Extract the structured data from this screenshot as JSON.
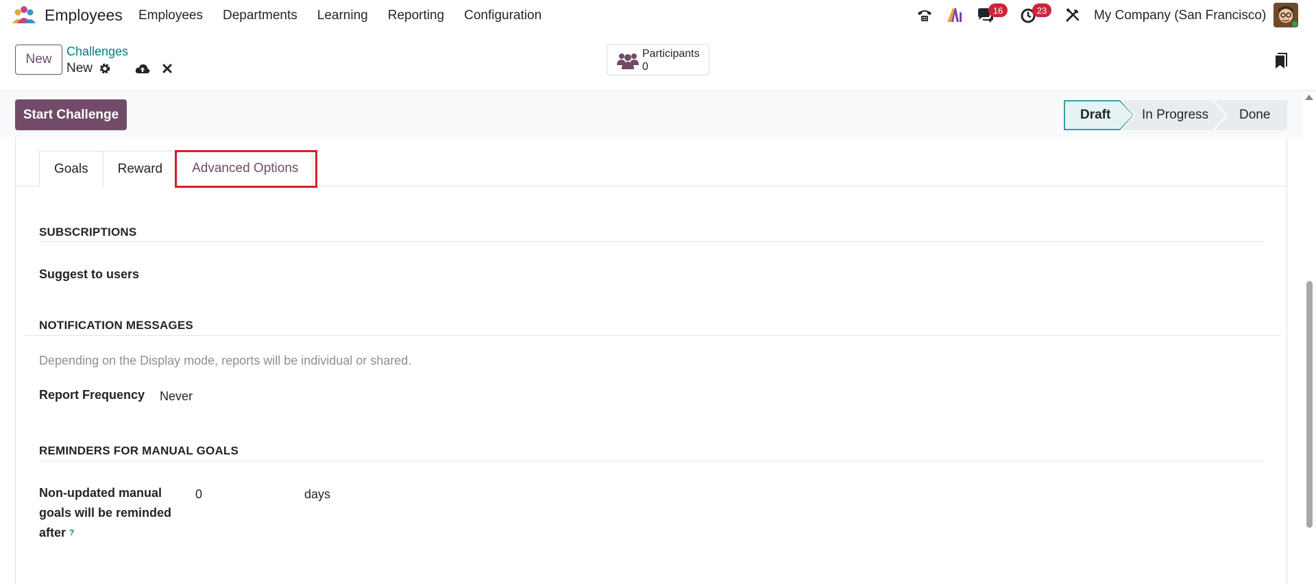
{
  "navbar": {
    "app_name": "Employees",
    "menu": [
      "Employees",
      "Departments",
      "Learning",
      "Reporting",
      "Configuration"
    ],
    "chat_badge": "16",
    "activity_badge": "23",
    "company": "My Company (San Francisco)",
    "icons": [
      "phone-icon",
      "ai-icon",
      "chat-icon",
      "clock-icon",
      "tools-icon"
    ]
  },
  "control": {
    "new_label": "New",
    "breadcrumb": "Challenges",
    "record_name": "New",
    "participants_label": "Participants",
    "participants_count": "0"
  },
  "statusbar": {
    "start_label": "Start Challenge",
    "stages": [
      "Draft",
      "In Progress",
      "Done"
    ],
    "active_stage": "Draft"
  },
  "tabs": [
    "Goals",
    "Reward",
    "Advanced Options"
  ],
  "active_tab": "Advanced Options",
  "sections": {
    "subscriptions": {
      "title": "SUBSCRIPTIONS",
      "suggest_label": "Suggest to users"
    },
    "notifications": {
      "title": "NOTIFICATION MESSAGES",
      "help": "Depending on the Display mode, reports will be individual or shared.",
      "frequency_label": "Report Frequency",
      "frequency_value": "Never"
    },
    "reminders": {
      "title": "REMINDERS FOR MANUAL GOALS",
      "label_line1": "Non-updated manual",
      "label_line2": "goals will be reminded",
      "label_line3": "after",
      "tooltip": "?",
      "value": "0",
      "unit": "days"
    }
  },
  "colors": {
    "brand": "#714b67",
    "link": "#017e84",
    "badge": "#d0243b",
    "highlight": "#d32027"
  }
}
